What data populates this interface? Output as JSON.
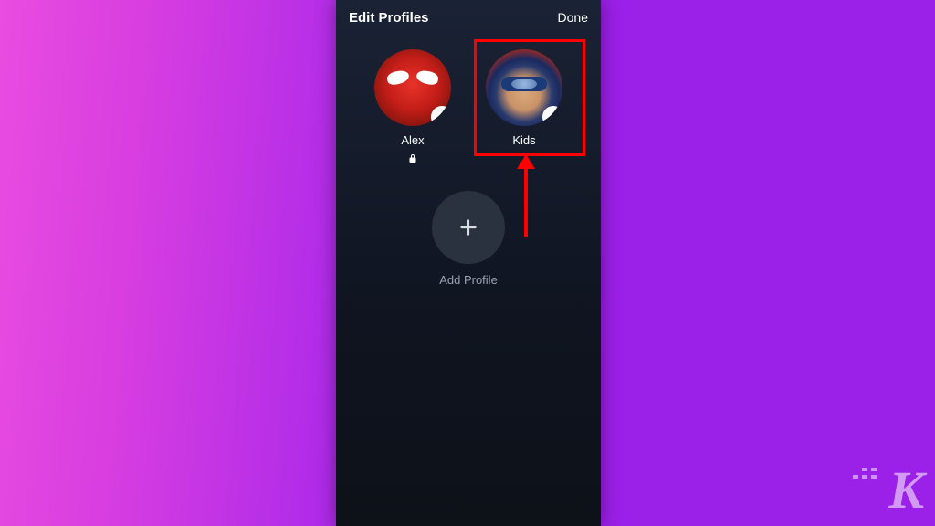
{
  "header": {
    "title": "Edit Profiles",
    "done": "Done"
  },
  "profiles": [
    {
      "name": "Alex",
      "locked": true
    },
    {
      "name": "Kids",
      "locked": false
    }
  ],
  "addProfile": {
    "label": "Add Profile"
  },
  "annotation": {
    "highlight": "red",
    "arrow_target": "Kids"
  }
}
